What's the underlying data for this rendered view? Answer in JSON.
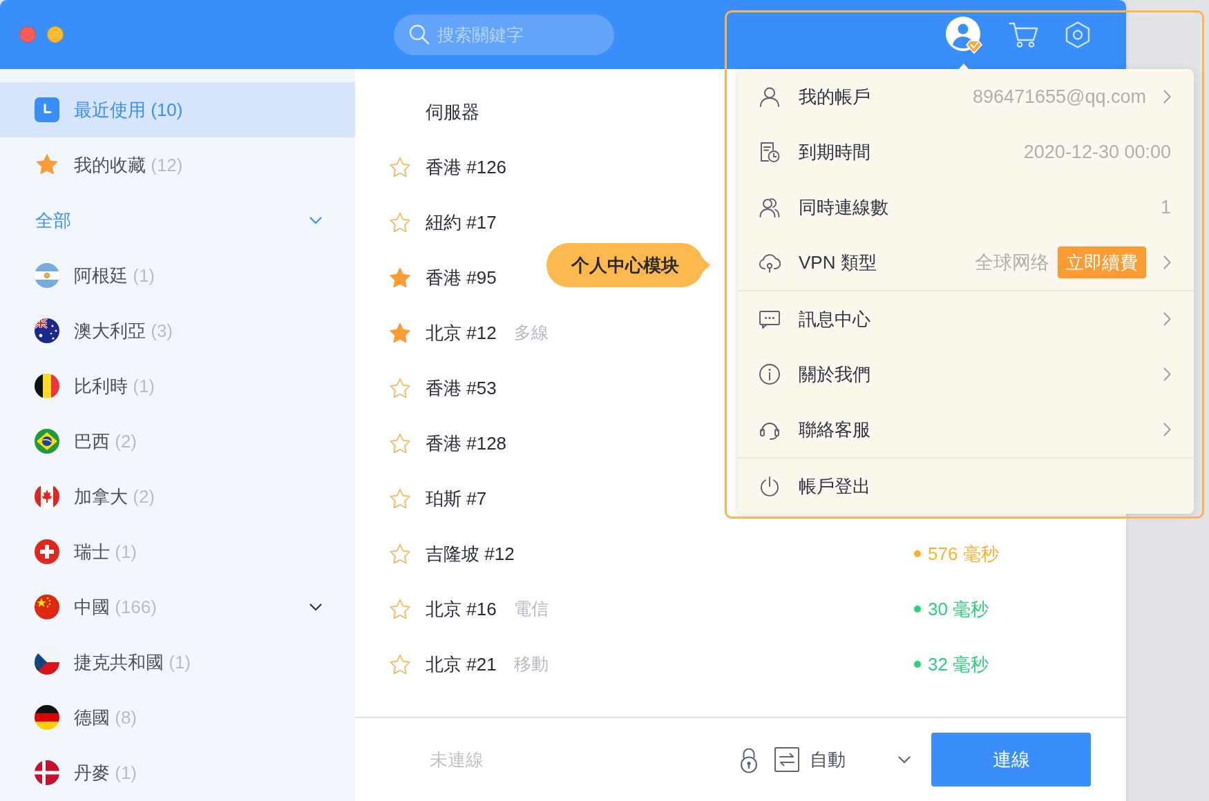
{
  "search": {
    "placeholder": "搜索關鍵字"
  },
  "sidebar": {
    "shortcuts": [
      {
        "kind": "recent",
        "label": "最近使用",
        "count": "(10)",
        "selected": true
      },
      {
        "kind": "favorites",
        "label": "我的收藏",
        "count": "(12)",
        "selected": false
      }
    ],
    "section": {
      "label": "全部",
      "expanded": true
    },
    "countries": [
      {
        "kind": "argentina",
        "label": "阿根廷",
        "count": "(1)",
        "selected": false,
        "has_children": false
      },
      {
        "kind": "australia",
        "label": "澳大利亞",
        "count": "(3)",
        "selected": false,
        "has_children": false
      },
      {
        "kind": "belgium",
        "label": "比利時",
        "count": "(1)",
        "selected": false,
        "has_children": false
      },
      {
        "kind": "brazil",
        "label": "巴西",
        "count": "(2)",
        "selected": false,
        "has_children": false
      },
      {
        "kind": "canada",
        "label": "加拿大",
        "count": "(2)",
        "selected": false,
        "has_children": false
      },
      {
        "kind": "switzerland",
        "label": "瑞士",
        "count": "(1)",
        "selected": false,
        "has_children": false
      },
      {
        "kind": "china",
        "label": "中國",
        "count": "(166)",
        "selected": false,
        "has_children": true
      },
      {
        "kind": "czechia",
        "label": "捷克共和國",
        "count": "(1)",
        "selected": false,
        "has_children": false
      },
      {
        "kind": "germany",
        "label": "德國",
        "count": "(8)",
        "selected": false,
        "has_children": false
      },
      {
        "kind": "denmark",
        "label": "丹麥",
        "count": "(1)",
        "selected": false,
        "has_children": false
      }
    ]
  },
  "server_list": {
    "heading": "伺服器",
    "rows": [
      {
        "name": "香港 #126",
        "favorite": false
      },
      {
        "name": "紐約 #17",
        "favorite": false
      },
      {
        "name": "香港 #95",
        "favorite": true
      },
      {
        "name": "北京 #12",
        "tag": "多線",
        "favorite": true
      },
      {
        "name": "香港 #53",
        "favorite": false
      },
      {
        "name": "香港 #128",
        "favorite": false
      },
      {
        "name": "珀斯 #7",
        "favorite": false
      },
      {
        "name": "吉隆坡 #12",
        "favorite": false,
        "latency": "576 毫秒",
        "color": "#f7b32c"
      },
      {
        "name": "北京 #16",
        "tag": "電信",
        "favorite": false,
        "latency": "30 毫秒",
        "color": "#2ccf7b"
      },
      {
        "name": "北京 #21",
        "tag": "移動",
        "favorite": false,
        "latency": "32 毫秒",
        "color": "#2ccf7b"
      }
    ]
  },
  "bottom_bar": {
    "status": "未連線",
    "mode": "自動",
    "button": "連線"
  },
  "account_menu": {
    "open": true,
    "sections": [
      {
        "items": [
          {
            "kind": "account",
            "label": "我的帳戶",
            "value": "896471655@qq.com",
            "has_submenu": true
          },
          {
            "kind": "expiry",
            "label": "到期時間",
            "value": "2020-12-30 00:00",
            "has_submenu": false
          },
          {
            "kind": "connections",
            "label": "同時連線數",
            "value": "1",
            "has_submenu": false
          },
          {
            "kind": "plan",
            "label": "VPN 類型",
            "value": "全球网络",
            "action": "立即續費",
            "has_submenu": true
          }
        ]
      },
      {
        "items": [
          {
            "kind": "messages",
            "label": "訊息中心",
            "has_submenu": true
          },
          {
            "kind": "about",
            "label": "關於我們",
            "has_submenu": true
          },
          {
            "kind": "support",
            "label": "聯絡客服",
            "has_submenu": true
          }
        ]
      },
      {
        "items": [
          {
            "kind": "logout",
            "label": "帳戶登出",
            "has_submenu": false
          }
        ]
      }
    ]
  },
  "annotation": {
    "label": "个人中心模块"
  }
}
